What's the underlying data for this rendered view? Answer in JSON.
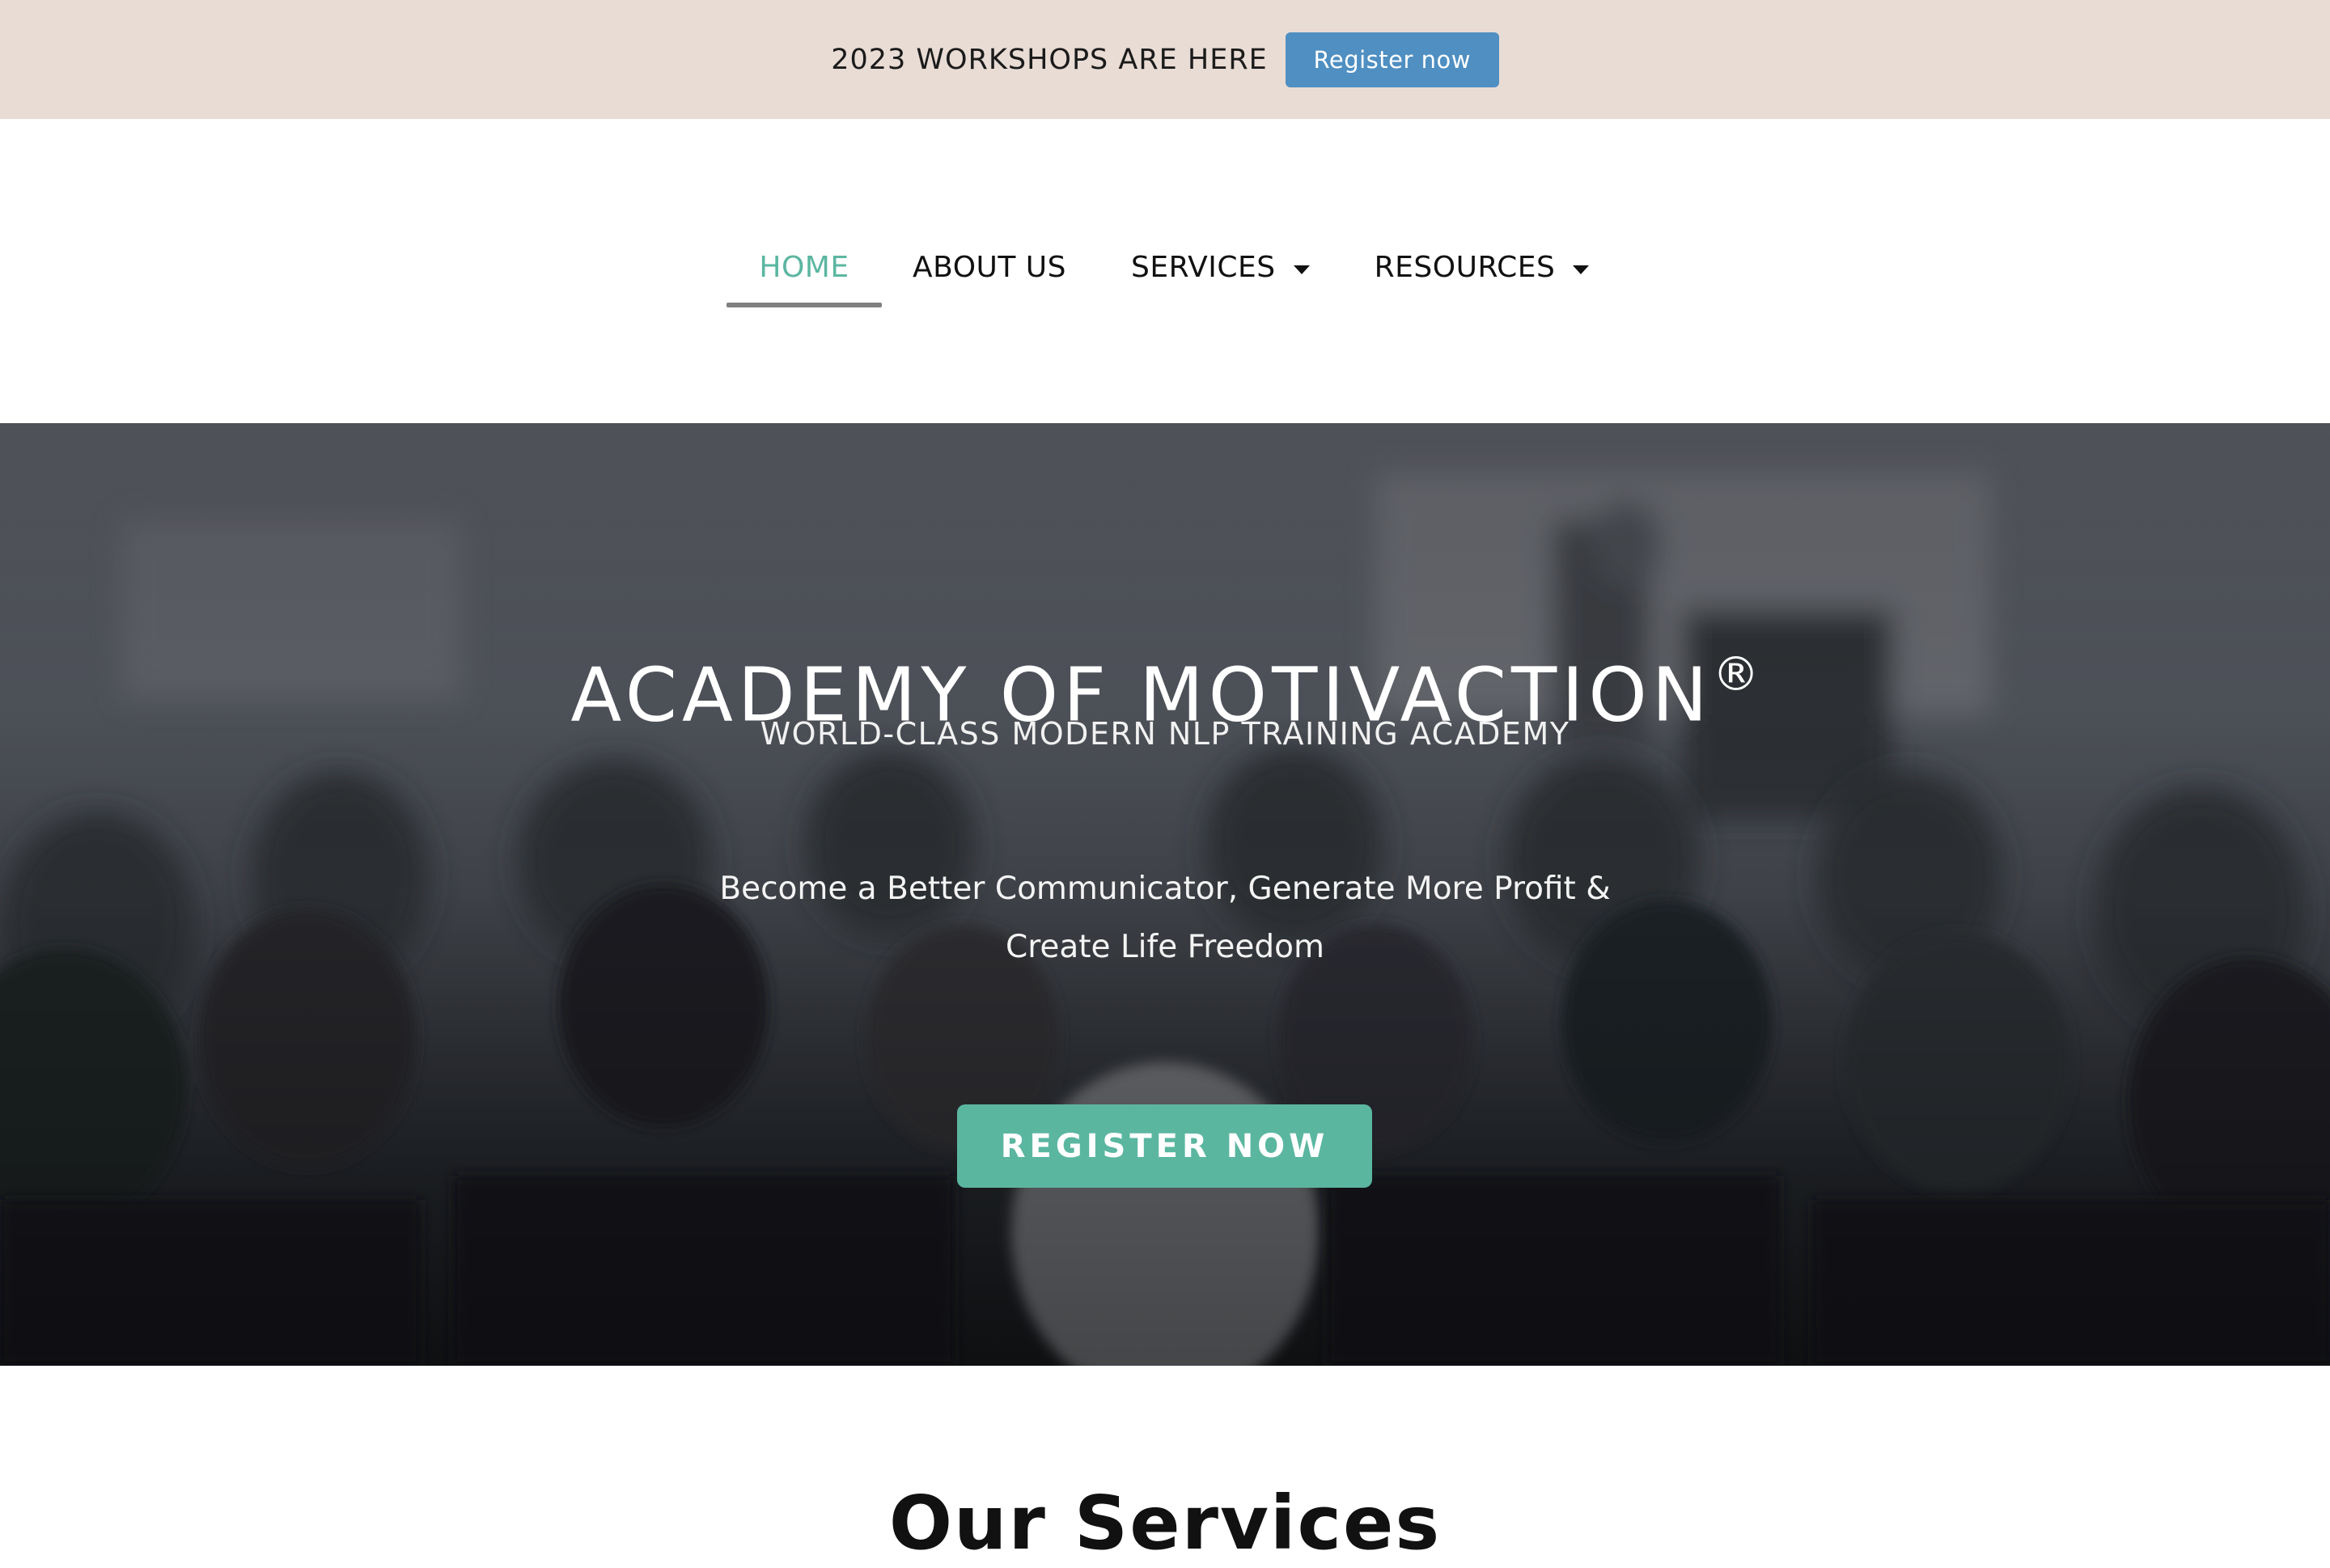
{
  "announcement": {
    "text": "2023 WORKSHOPS ARE HERE",
    "button_label": "Register now",
    "background_color": "#e9dcd5",
    "button_color": "#4f8fc2"
  },
  "nav": {
    "items": [
      {
        "label": "HOME",
        "active": true,
        "has_dropdown": false
      },
      {
        "label": "ABOUT US",
        "active": false,
        "has_dropdown": false
      },
      {
        "label": "SERVICES",
        "active": false,
        "has_dropdown": true
      },
      {
        "label": "RESOURCES",
        "active": false,
        "has_dropdown": true
      }
    ],
    "active_color": "#5bb6a0"
  },
  "hero": {
    "title": "ACADEMY OF MOTIVACTION",
    "title_mark": "®",
    "subtitle": "WORLD-CLASS MODERN NLP TRAINING ACADEMY",
    "tagline_line1": "Become a Better Communicator, Generate More Profit &",
    "tagline_line2": "Create Life Freedom",
    "cta_label": "REGISTER NOW",
    "cta_color": "#5bb6a0"
  },
  "services": {
    "heading": "Our Services"
  }
}
